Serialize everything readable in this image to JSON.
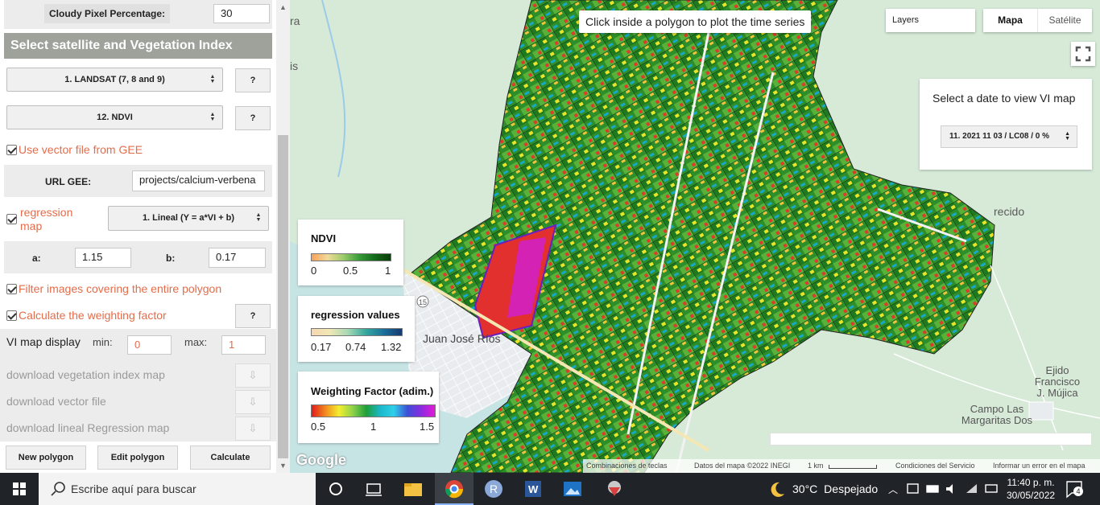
{
  "panel": {
    "cloudy_label": "Cloudy Pixel Percentage:",
    "cloudy_value": "30",
    "section_header": "Select satellite and Vegetation Index",
    "satellite_select": "1. LANDSAT (7, 8 and 9)",
    "index_select": "12. NDVI",
    "help_label": "?",
    "use_vector_label": "Use vector file from GEE",
    "url_label": "URL GEE:",
    "url_value": "projects/calcium-verbena",
    "regression_label_1": "regression",
    "regression_label_2": "map",
    "regression_select": "1. Lineal (Y = a*VI + b)",
    "a_label": "a:",
    "a_value": "1.15",
    "b_label": "b:",
    "b_value": "0.17",
    "filter_label": "Filter images covering the entire polygon",
    "weighting_label": "Calculate the weighting factor",
    "vi_display_label": "VI map display",
    "min_label": "min:",
    "min_value": "0",
    "max_label": "max:",
    "max_value": "1",
    "download_vi": "download vegetation index map",
    "download_vector": "download vector file",
    "download_regression": "download lineal Regression map",
    "download_icon": "⇩",
    "new_polygon": "New polygon",
    "edit_polygon": "Edit polygon",
    "calculate": "Calculate"
  },
  "map": {
    "tip": "Click inside a polygon to plot the time series",
    "layers": "Layers",
    "map_type": [
      "Mapa",
      "Satélite"
    ],
    "date_title": "Select a date to view VI map",
    "date_select": "11. 2021 11 03 / LC08 / 0 %",
    "labels": {
      "juan_jose": "Juan José Ríos",
      "ejido": [
        "Ejido",
        "Francisco",
        "J. Mújica"
      ],
      "campo": [
        "Campo Las",
        "Margaritas Dos"
      ],
      "recido": "recido",
      "ra": "ra",
      "is": "is",
      "road_15": "15"
    },
    "legends": [
      {
        "title": "NDVI",
        "ticks": [
          "0",
          "0.5",
          "1"
        ]
      },
      {
        "title": "regression values",
        "ticks": [
          "0.17",
          "0.74",
          "1.32"
        ]
      },
      {
        "title": "Weighting Factor (adim.)",
        "ticks": [
          "0.5",
          "1",
          "1.5"
        ]
      }
    ],
    "google": "Google",
    "attribution": {
      "shortcuts": "Combinaciones de teclas",
      "data": "Datos del mapa ©2022 INEGI",
      "scale": "1 km",
      "terms": "Condiciones del Servicio",
      "report": "Informar un error en el mapa"
    }
  },
  "taskbar": {
    "search_placeholder": "Escribe aquí para buscar",
    "temperature": "30°C",
    "weather": "Despejado",
    "time": "11:40 p. m.",
    "date": "30/05/2022",
    "notifications": "4"
  },
  "colors": {
    "accent_header": "#9ea29b",
    "check_label": "#e46c4a",
    "map_background": "#d7ead8",
    "taskbar": "#202428"
  }
}
